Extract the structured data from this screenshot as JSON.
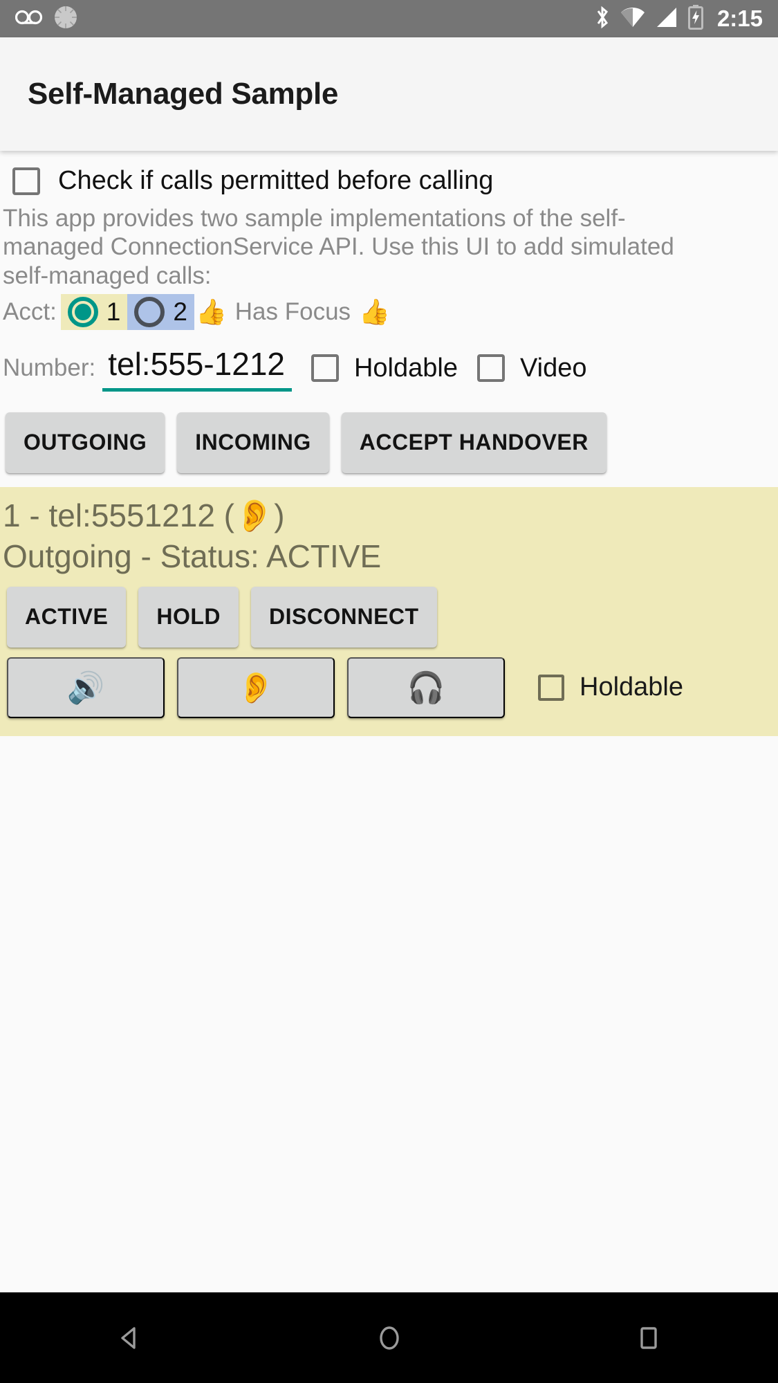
{
  "status_bar": {
    "time": "2:15",
    "left_icons": [
      "voicemail-icon",
      "sync-spinner-icon"
    ],
    "right_icons": [
      "bluetooth-icon",
      "wifi-icon",
      "signal-icon",
      "battery-charging-icon"
    ],
    "background_color": "#757575"
  },
  "app_bar": {
    "title": "Self-Managed Sample",
    "background_color": "#f5f5f5"
  },
  "permit": {
    "label": "Check if calls permitted before calling",
    "checked": false
  },
  "description": "This app provides two sample implementations of the self-managed ConnectionService API.  Use this UI to add simulated self-managed calls:",
  "account": {
    "label": "Acct:",
    "options": [
      {
        "value": "1",
        "selected": true,
        "highlight_color": "#efeaba"
      },
      {
        "value": "2",
        "selected": false,
        "highlight_color": "#aec3e8"
      }
    ],
    "focus_emoji_left": "👍",
    "focus_text": "Has Focus",
    "focus_emoji_right": "👍"
  },
  "number": {
    "label": "Number:",
    "value": "tel:555-1212",
    "placeholder": "tel:555-1212",
    "underline_color": "#009688",
    "holdable": {
      "label": "Holdable",
      "checked": false
    },
    "video": {
      "label": "Video",
      "checked": false
    }
  },
  "actions": [
    {
      "label": "OUTGOING",
      "name": "outgoing-button"
    },
    {
      "label": "INCOMING",
      "name": "incoming-button"
    },
    {
      "label": "ACCEPT HANDOVER",
      "name": "accept-handover-button"
    }
  ],
  "call": {
    "background_color": "#efeaba",
    "text_color": "#6f6d55",
    "title_prefix": "1 - tel:5551212 ( ",
    "title_emoji": "👂",
    "title_suffix": " )",
    "status_line": "Outgoing - Status: ACTIVE",
    "state_buttons": [
      {
        "label": "ACTIVE",
        "name": "call-active-button"
      },
      {
        "label": "HOLD",
        "name": "call-hold-button"
      },
      {
        "label": "DISCONNECT",
        "name": "call-disconnect-button"
      }
    ],
    "audio_buttons": [
      {
        "emoji": "🔊",
        "name": "audio-speaker-button"
      },
      {
        "emoji": "👂",
        "name": "audio-earpiece-button"
      },
      {
        "emoji": "🎧",
        "name": "audio-headset-button"
      }
    ],
    "holdable": {
      "label": "Holdable",
      "checked": false
    }
  },
  "nav_bar": {
    "background_color": "#000000",
    "buttons": [
      "back-nav-button",
      "home-nav-button",
      "recents-nav-button"
    ]
  }
}
